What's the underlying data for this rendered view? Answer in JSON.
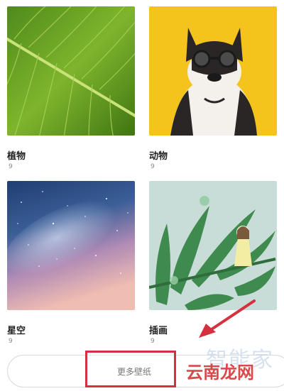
{
  "categories": [
    {
      "label": "植物",
      "count": "9",
      "icon": "leaf-wallpaper"
    },
    {
      "label": "动物",
      "count": "9",
      "icon": "dog-wallpaper"
    },
    {
      "label": "星空",
      "count": "9",
      "icon": "starry-sky-wallpaper"
    },
    {
      "label": "插画",
      "count": "9",
      "icon": "illustration-wallpaper"
    }
  ],
  "more_button": {
    "label": "更多壁纸"
  },
  "watermark": {
    "top": "智能家",
    "bottom": "云南龙网"
  },
  "colors": {
    "highlight": "#d5303e"
  }
}
